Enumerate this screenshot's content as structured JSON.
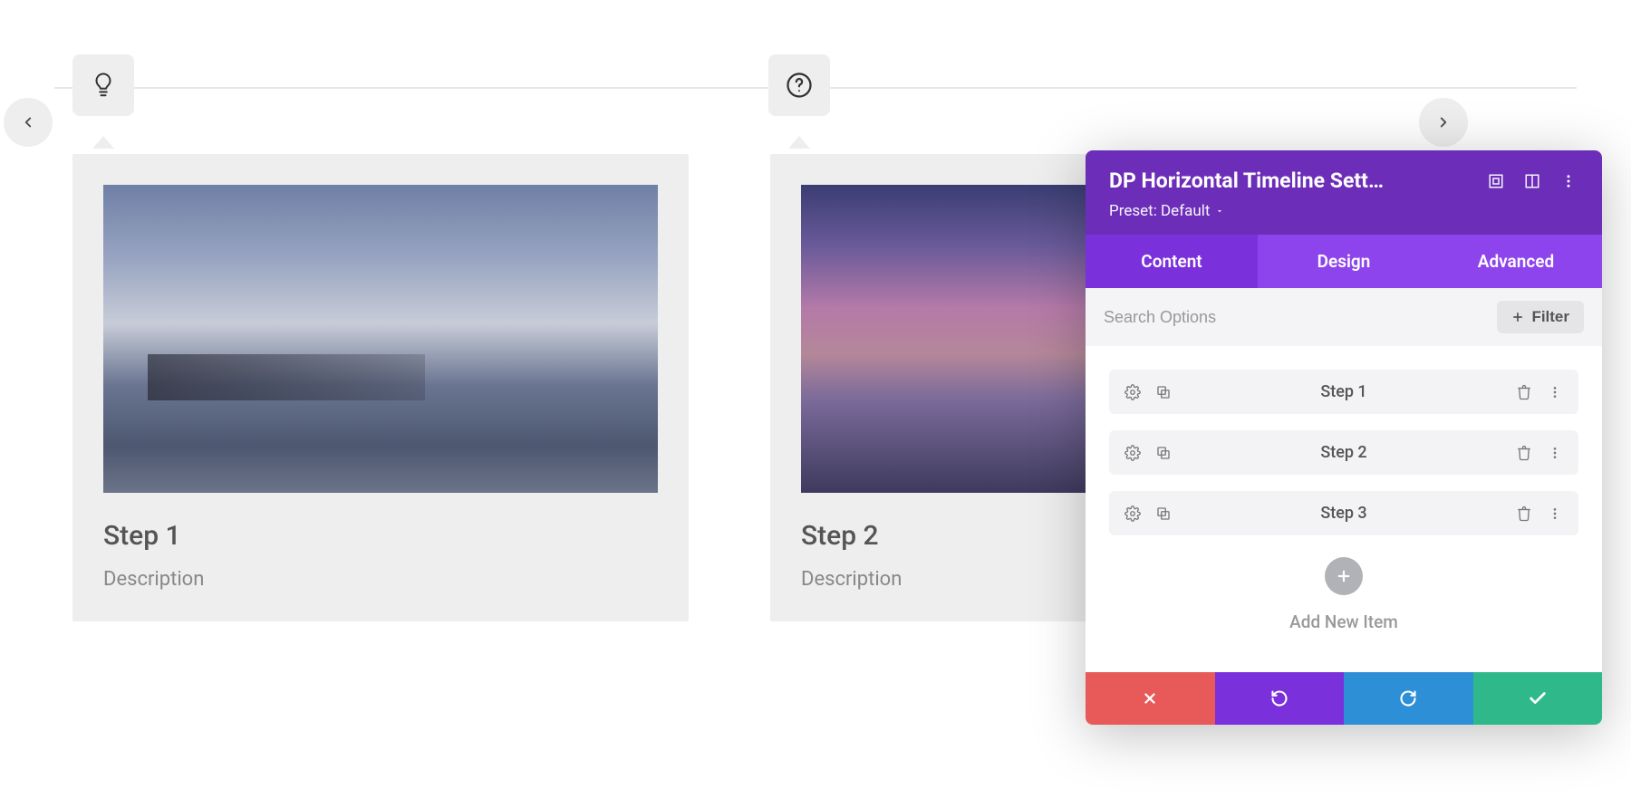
{
  "timeline": {
    "cards": [
      {
        "title": "Step 1",
        "desc": "Description"
      },
      {
        "title": "Step 2",
        "desc": "Description"
      }
    ]
  },
  "panel": {
    "title": "DP Horizontal Timeline Sett…",
    "preset": "Preset: Default",
    "tabs": {
      "content": "Content",
      "design": "Design",
      "advanced": "Advanced"
    },
    "search_placeholder": "Search Options",
    "filter_label": "Filter",
    "items": [
      {
        "label": "Step 1"
      },
      {
        "label": "Step 2"
      },
      {
        "label": "Step 3"
      }
    ],
    "add_label": "Add New Item"
  }
}
